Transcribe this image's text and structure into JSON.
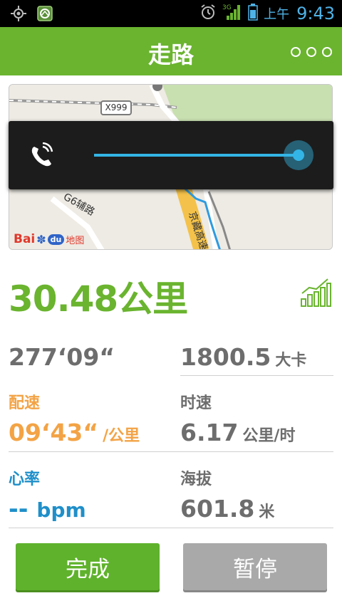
{
  "status_bar": {
    "ampm": "上午",
    "time": "9:43",
    "network": "3G"
  },
  "app_bar": {
    "title": "走路"
  },
  "map": {
    "road_label": "X999",
    "road_name_vertical": "G6辅路",
    "expressway_name": "京藏高速",
    "brand_text": "Bai",
    "brand_du": "du",
    "brand_map": "地图"
  },
  "volume_overlay": {
    "stream": "in-call",
    "level": 1.0
  },
  "stats": {
    "distance": "30.48",
    "distance_unit": "公里",
    "duration": "277‘09“",
    "calories": "1800.5",
    "calories_unit": "大卡",
    "pace_label": "配速",
    "pace_value": "09‘43“",
    "pace_unit": "/公里",
    "speed_label": "时速",
    "speed_value": "6.17",
    "speed_unit": "公里/时",
    "heart_rate_label": "心率",
    "heart_rate_value": "--",
    "heart_rate_unit": "bpm",
    "altitude_label": "海拔",
    "altitude_value": "601.8",
    "altitude_unit": "米"
  },
  "buttons": {
    "finish": "完成",
    "pause": "暂停"
  },
  "colors": {
    "brand_green": "#6ab42f",
    "pace_orange": "#f3a345",
    "heart_blue": "#1f8fc9",
    "value_gray": "#6d6d6d",
    "volume_accent": "#33b5e5"
  },
  "icons": {
    "status_left": [
      "gps-icon",
      "app-notification-icon"
    ],
    "status_right": [
      "alarm-clock-icon",
      "signal-icon",
      "battery-icon"
    ],
    "overflow": "overflow-menu-icon",
    "chart": "bar-chart-icon",
    "volume": "phone-call-volume-icon"
  }
}
